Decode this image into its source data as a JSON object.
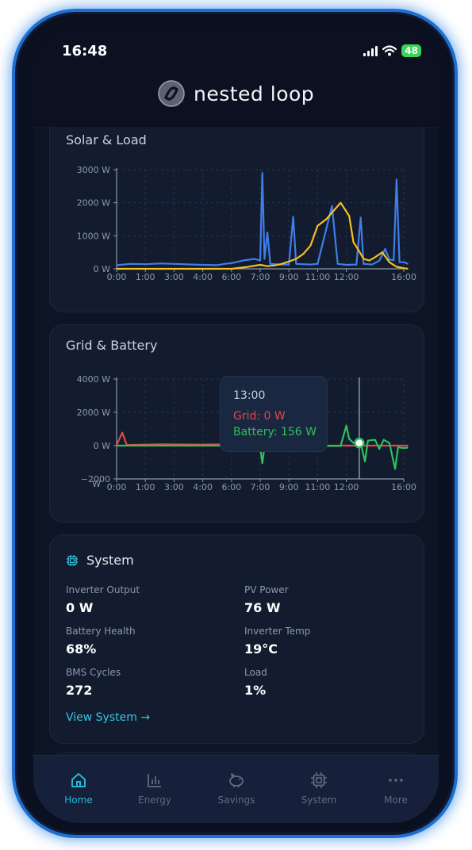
{
  "status_bar": {
    "time": "16:48",
    "battery": "48"
  },
  "app": {
    "brand": "nested loop"
  },
  "solar_load": {
    "title": "Solar & Load",
    "y_ticks": [
      "3000 W",
      "2000 W",
      "1000 W",
      "0 W"
    ],
    "x_ticks": [
      "0:00",
      "1:00",
      "3:00",
      "4:00",
      "6:00",
      "7:00",
      "9:00",
      "11:00",
      "12:00",
      "16:00"
    ]
  },
  "grid_battery": {
    "title": "Grid & Battery",
    "y_ticks": [
      "4000 W",
      "2000 W",
      "0 W",
      "−2000"
    ],
    "y_unit_fragment": "W",
    "x_ticks": [
      "0:00",
      "1:00",
      "3:00",
      "4:00",
      "6:00",
      "7:00",
      "9:00",
      "11:00",
      "12:00",
      "16:00"
    ],
    "tooltip": {
      "time": "13:00",
      "grid": "Grid: 0 W",
      "battery": "Battery: 156 W"
    }
  },
  "system": {
    "title": "System",
    "stats": [
      {
        "label": "Inverter Output",
        "value": "0 W"
      },
      {
        "label": "PV Power",
        "value": "76 W"
      },
      {
        "label": "Battery Health",
        "value": "68%"
      },
      {
        "label": "Inverter Temp",
        "value": "19°C"
      },
      {
        "label": "BMS Cycles",
        "value": "272"
      },
      {
        "label": "Load",
        "value": "1%"
      }
    ],
    "link": "View System →"
  },
  "tabs": [
    {
      "label": "Home",
      "icon": "home-icon",
      "active": true
    },
    {
      "label": "Energy",
      "icon": "bar-chart-icon",
      "active": false
    },
    {
      "label": "Savings",
      "icon": "piggy-bank-icon",
      "active": false
    },
    {
      "label": "System",
      "icon": "chip-icon",
      "active": false
    },
    {
      "label": "More",
      "icon": "more-dots-icon",
      "active": false
    }
  ],
  "colors": {
    "solar": "#f4c11f",
    "load": "#3f7ee8",
    "grid": "#e04848",
    "battery": "#2fc05a",
    "accent": "#23b8d8"
  },
  "chart_data": [
    {
      "type": "line",
      "title": "Solar & Load",
      "x_ticks": [
        "0:00",
        "1:00",
        "3:00",
        "4:00",
        "6:00",
        "7:00",
        "9:00",
        "11:00",
        "12:00",
        "16:00"
      ],
      "ylim": [
        0,
        3000
      ],
      "grid": true,
      "series": [
        {
          "name": "Load",
          "color": "#3f7ee8",
          "points": [
            [
              0,
              110
            ],
            [
              0.5,
              150
            ],
            [
              1,
              140
            ],
            [
              2,
              160
            ],
            [
              3,
              150
            ],
            [
              4,
              120
            ],
            [
              5,
              110
            ],
            [
              5.5,
              150
            ],
            [
              6,
              170
            ],
            [
              6.4,
              250
            ],
            [
              6.8,
              300
            ],
            [
              7,
              250
            ],
            [
              7.15,
              2900
            ],
            [
              7.3,
              300
            ],
            [
              7.5,
              1100
            ],
            [
              7.7,
              150
            ],
            [
              8.5,
              130
            ],
            [
              9,
              130
            ],
            [
              9.3,
              1580
            ],
            [
              9.5,
              150
            ],
            [
              10,
              140
            ],
            [
              10.5,
              130
            ],
            [
              11,
              150
            ],
            [
              11.5,
              1900
            ],
            [
              11.7,
              150
            ],
            [
              12,
              120
            ],
            [
              12.7,
              130
            ],
            [
              13,
              1550
            ],
            [
              13.2,
              150
            ],
            [
              13.8,
              130
            ],
            [
              14.3,
              250
            ],
            [
              14.7,
              600
            ],
            [
              15,
              280
            ],
            [
              15.3,
              260
            ],
            [
              15.5,
              2700
            ],
            [
              15.7,
              200
            ],
            [
              16,
              200
            ],
            [
              16.5,
              150
            ]
          ]
        },
        {
          "name": "Solar",
          "color": "#f4c11f",
          "points": [
            [
              0,
              0
            ],
            [
              6,
              0
            ],
            [
              6.5,
              50
            ],
            [
              7,
              120
            ],
            [
              7.5,
              80
            ],
            [
              8,
              100
            ],
            [
              8.5,
              150
            ],
            [
              9,
              220
            ],
            [
              9.5,
              300
            ],
            [
              10,
              450
            ],
            [
              10.5,
              700
            ],
            [
              11,
              1300
            ],
            [
              11.3,
              1500
            ],
            [
              11.6,
              1800
            ],
            [
              11.8,
              2000
            ],
            [
              12.2,
              1600
            ],
            [
              12.5,
              800
            ],
            [
              12.8,
              600
            ],
            [
              13.2,
              300
            ],
            [
              13.6,
              250
            ],
            [
              14,
              350
            ],
            [
              14.5,
              500
            ],
            [
              15,
              200
            ],
            [
              15.5,
              60
            ],
            [
              16,
              20
            ],
            [
              16.5,
              0
            ]
          ]
        }
      ]
    },
    {
      "type": "line",
      "title": "Grid & Battery",
      "x_ticks": [
        "0:00",
        "1:00",
        "3:00",
        "4:00",
        "6:00",
        "7:00",
        "9:00",
        "11:00",
        "12:00",
        "16:00"
      ],
      "ylim": [
        -2000,
        4000
      ],
      "grid": true,
      "series": [
        {
          "name": "Grid",
          "color": "#e04848",
          "points": [
            [
              0,
              40
            ],
            [
              0.2,
              780
            ],
            [
              0.35,
              40
            ],
            [
              1,
              60
            ],
            [
              2,
              80
            ],
            [
              3,
              70
            ],
            [
              4,
              60
            ],
            [
              5,
              70
            ],
            [
              5.8,
              50
            ],
            [
              6,
              0
            ],
            [
              16.5,
              0
            ]
          ]
        },
        {
          "name": "Battery",
          "color": "#2fc05a",
          "points": [
            [
              0,
              0
            ],
            [
              5.5,
              0
            ],
            [
              6,
              -200
            ],
            [
              6.4,
              -80
            ],
            [
              7,
              -100
            ],
            [
              7.15,
              -1050
            ],
            [
              7.3,
              -80
            ],
            [
              8,
              -60
            ],
            [
              9,
              -40
            ],
            [
              11,
              -30
            ],
            [
              11.8,
              -20
            ],
            [
              12,
              1200
            ],
            [
              12.2,
              400
            ],
            [
              12.5,
              156
            ],
            [
              13,
              156
            ],
            [
              13.3,
              -950
            ],
            [
              13.5,
              300
            ],
            [
              14,
              350
            ],
            [
              14.3,
              -200
            ],
            [
              14.6,
              350
            ],
            [
              15,
              150
            ],
            [
              15.4,
              -1400
            ],
            [
              15.6,
              -100
            ],
            [
              16,
              -150
            ],
            [
              16.5,
              -120
            ]
          ]
        }
      ],
      "marker_x": 12.9
    }
  ]
}
